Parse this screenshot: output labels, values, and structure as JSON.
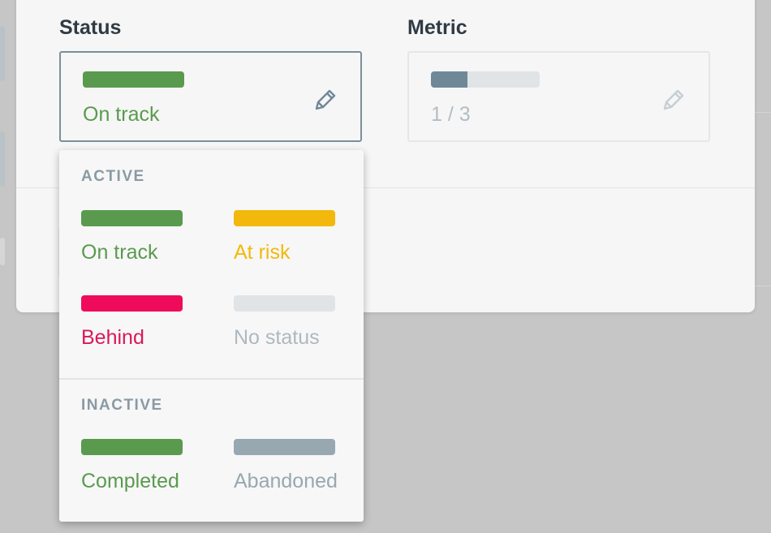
{
  "status_field": {
    "title": "Status",
    "selected_label": "On track",
    "selected_color": "#5a9a4f",
    "edit_icon": "pencil-icon"
  },
  "metric_field": {
    "title": "Metric",
    "value_text": "1 / 3",
    "progress_fraction": 0.333,
    "progress_color": "#6f8898",
    "track_color": "#e1e4e6",
    "edit_icon": "pencil-icon"
  },
  "status_menu": {
    "groups": [
      {
        "label": "ACTIVE",
        "options": [
          {
            "label": "On track",
            "color": "#5a9a4f"
          },
          {
            "label": "At risk",
            "color": "#f2b90c"
          },
          {
            "label": "Behind",
            "color": "#ee0c5a",
            "text_color": "#d9195a"
          },
          {
            "label": "No status",
            "color": "#e1e4e6",
            "text_color": "#aeb8bf"
          }
        ]
      },
      {
        "label": "INACTIVE",
        "options": [
          {
            "label": "Completed",
            "color": "#5a9a4f"
          },
          {
            "label": "Abandoned",
            "color": "#98a8b1",
            "text_color": "#98a8b1"
          }
        ]
      }
    ]
  }
}
